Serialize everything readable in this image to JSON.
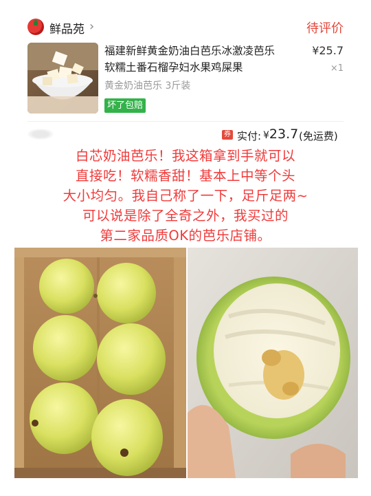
{
  "shop": {
    "name": "鲜品苑",
    "chevron": "›",
    "status": "待评价",
    "avatar_icon": "red-fruit-avatar-icon"
  },
  "product": {
    "title_line1": "福建新鲜黄金奶油白芭乐冰激凌芭乐",
    "title_line2": "软糯土番石榴孕妇水果鸡屎果",
    "price": "¥25.7",
    "quantity": "×1",
    "spec": "黄金奶油芭乐 3斤装",
    "tag": "坏了包赔",
    "tag_color": "#33b24a"
  },
  "payment": {
    "coupon_icon_text": "券",
    "label": "实付:",
    "currency": "¥",
    "amount": "23.7",
    "note": "(免运费)"
  },
  "review": {
    "color": "#f03a3a",
    "lines": [
      "白芯奶油芭乐！我这箱拿到手就可以",
      "直接吃！软糯香甜！基本上中等个头",
      "大小均匀。我自己称了一下，足斤足两~",
      "可以说是除了全奇之外，我买过的",
      "第二家品质OK的芭乐店铺。"
    ]
  },
  "photos": {
    "left": "guava-box-photo",
    "right": "bitten-guava-photo"
  }
}
